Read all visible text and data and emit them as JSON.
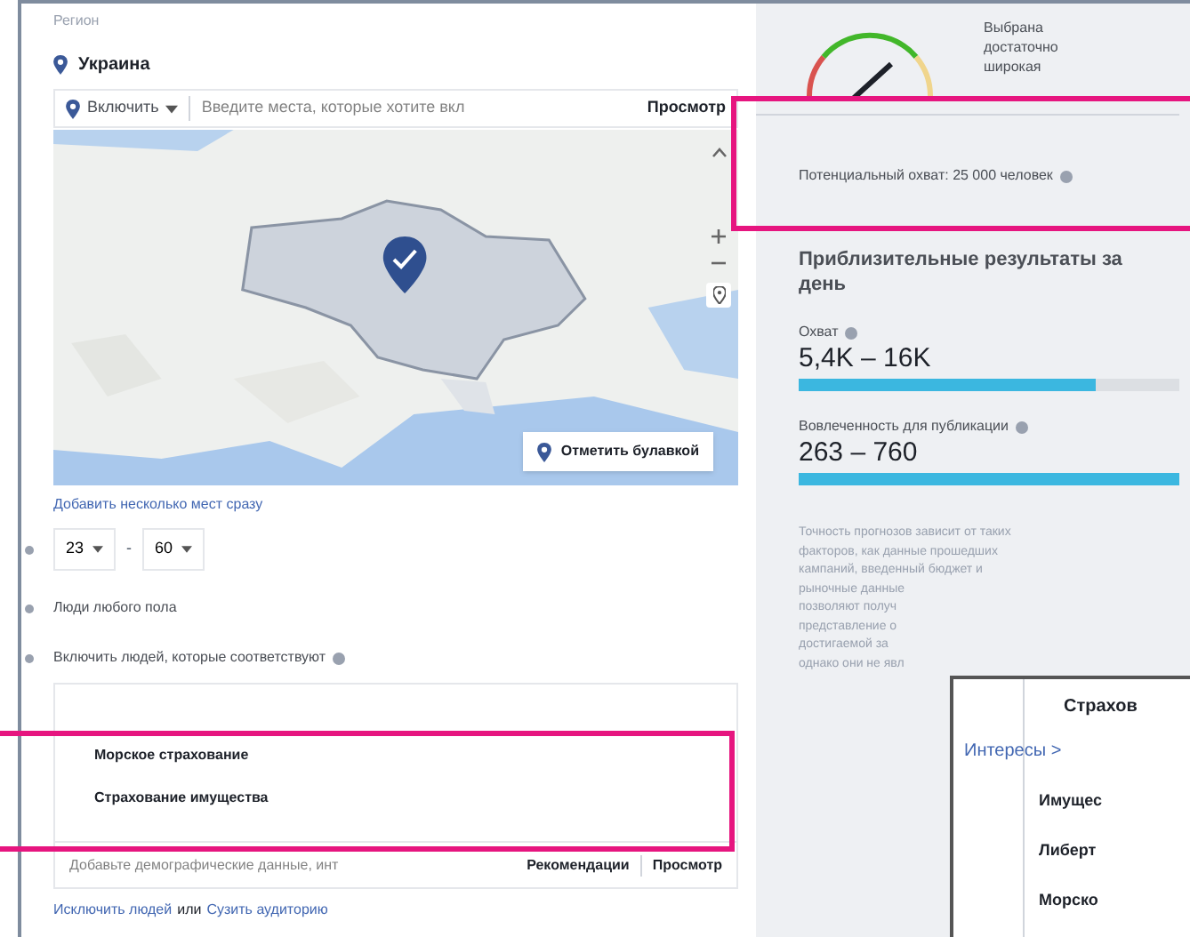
{
  "location": {
    "label": "Регион",
    "selected_place": "Украина",
    "include_mode": "Включить",
    "search_placeholder": "Введите места, которые хотите вкл",
    "browse": "Просмотр",
    "map": {
      "kind": "picture",
      "pin_button": "Отметить булавкой"
    },
    "bulk_link": "Добавить несколько мест сразу"
  },
  "age": {
    "from": "23",
    "separator": "-",
    "to": "60"
  },
  "gender": "Люди любого пола",
  "detailed_targeting": {
    "label": "Включить людей, которые соответствуют",
    "highlighted": true,
    "items": [
      "Морское страхование",
      "Страхование имущества"
    ],
    "placeholder": "Добавьте демографические данные, инт",
    "suggestions": "Рекомендации",
    "browse": "Просмотр",
    "exclude_link": "Исключить людей",
    "or": "или",
    "narrow_link": "Сузить аудиторию"
  },
  "audience": {
    "gauge_text": [
      "Выбрана",
      "достаточно",
      "широкая"
    ],
    "potential_reach": "Потенциальный охват: 25 000 человек",
    "highlighted": true
  },
  "estimates": {
    "title": "Приблизительные результаты за день",
    "metrics": [
      {
        "label": "Охват",
        "value": "5,4K – 16K",
        "level": 0.78
      },
      {
        "label": "Вовлеченность для публикации",
        "value": "263 – 760",
        "level": 1.0
      }
    ],
    "note_lines": [
      "Точность прогнозов зависит от таких",
      "факторов, как данные прошедших",
      "кампаний, введенный бюджет и",
      "рыночные данные",
      "позволяют получ",
      "представление о",
      "достигаемой за",
      "однако они не явл"
    ]
  },
  "popup": {
    "title": "Страхов",
    "breadcrumb": "Интересы >",
    "items": [
      "Имущес",
      "Либерт",
      "Морско"
    ]
  }
}
